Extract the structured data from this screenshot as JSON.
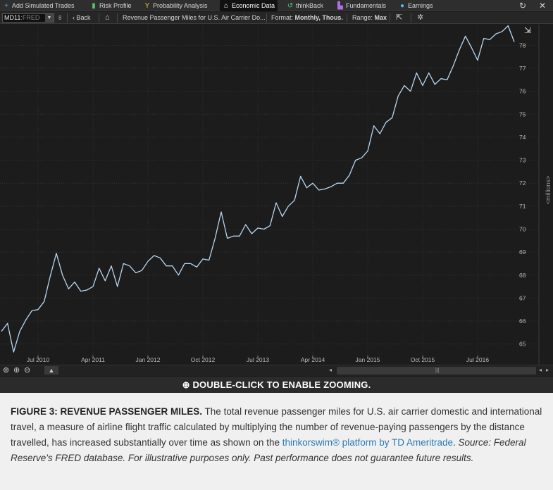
{
  "topbar": {
    "tabs": [
      {
        "label": "Add Simulated Trades",
        "icon": "plus-icon"
      },
      {
        "label": "Risk Profile",
        "icon": "risk-profile-icon"
      },
      {
        "label": "Probability Analysis",
        "icon": "probability-icon"
      },
      {
        "label": "Economic Data",
        "icon": "bank-icon"
      },
      {
        "label": "thinkBack",
        "icon": "rewind-icon"
      },
      {
        "label": "Fundamentals",
        "icon": "bar-chart-icon"
      },
      {
        "label": "Earnings",
        "icon": "lightbulb-icon"
      }
    ],
    "right_icons": [
      "refresh-icon",
      "close-icon"
    ]
  },
  "toolbar": {
    "symbol_main": "MD11",
    "symbol_suffix": ":FRED",
    "back_label": "Back",
    "series_title": "Revenue Passenger Miles for U.S. Air Carrier Do...",
    "format_label": "Format: ",
    "format_value": "Monthly, Thous.",
    "range_label": "Range: ",
    "range_value": "Max"
  },
  "chart_data": {
    "type": "line",
    "title": "",
    "xlabel": "",
    "ylabel": "<millions>",
    "x_tick_labels": [
      "Jul 2010",
      "Apr 2011",
      "Jan 2012",
      "Oct 2012",
      "Jul 2013",
      "Apr 2014",
      "Jan 2015",
      "Oct 2015",
      "Jul 2016"
    ],
    "y_ticks": [
      65,
      66,
      67,
      68,
      69,
      70,
      71,
      72,
      73,
      74,
      75,
      76,
      77,
      78
    ],
    "ylim": [
      64.5,
      78.9
    ],
    "x_start": "Jan 2010",
    "x_end": "Oct 2016",
    "grid": true,
    "series": [
      {
        "values": [
          65.55,
          65.9,
          64.65,
          65.55,
          66.05,
          66.45,
          66.5,
          66.85,
          67.95,
          68.95,
          68.0,
          67.4,
          67.7,
          67.3,
          67.35,
          67.5,
          68.3,
          67.75,
          68.4,
          67.5,
          68.5,
          68.4,
          68.1,
          68.2,
          68.6,
          68.85,
          68.75,
          68.4,
          68.4,
          68.0,
          68.5,
          68.5,
          68.35,
          68.7,
          68.65,
          69.6,
          70.75,
          69.6,
          69.7,
          69.7,
          70.2,
          69.8,
          70.05,
          70.0,
          70.15,
          71.15,
          70.55,
          71.0,
          71.25,
          72.3,
          71.8,
          72.0,
          71.7,
          71.75,
          71.85,
          72.0,
          72.0,
          72.35,
          73.0,
          73.1,
          73.4,
          74.5,
          74.15,
          74.65,
          74.85,
          75.8,
          76.25,
          76.0,
          76.8,
          76.25,
          76.8,
          76.3,
          76.55,
          76.5,
          77.1,
          77.8,
          78.4,
          77.9,
          77.35,
          78.3,
          78.25,
          78.5,
          78.6,
          78.85,
          78.15
        ]
      }
    ]
  },
  "bottom": {
    "zoom_banner": "DOUBLE-CLICK TO ENABLE ZOOMING."
  },
  "caption": {
    "lead": "FIGURE 3: REVENUE PASSENGER MILES.",
    "body": " The total revenue passenger miles for U.S. air carrier domestic and international travel, a measure of airline flight traffic calculated by multiplying the number of revenue-paying passengers by the distance travelled, has increased substantially over time as shown on the ",
    "link": "thinkorswim® platform by TD Ameritrade",
    "period": ". ",
    "source": "Source: Federal Reserve's FRED database. For illustrative purposes only. Past performance does not guarantee future results."
  },
  "colors": {
    "line": "#b8d6f0",
    "background": "#1c1c1c",
    "grid": "#3a3a3a",
    "link": "#2a7ab8"
  }
}
